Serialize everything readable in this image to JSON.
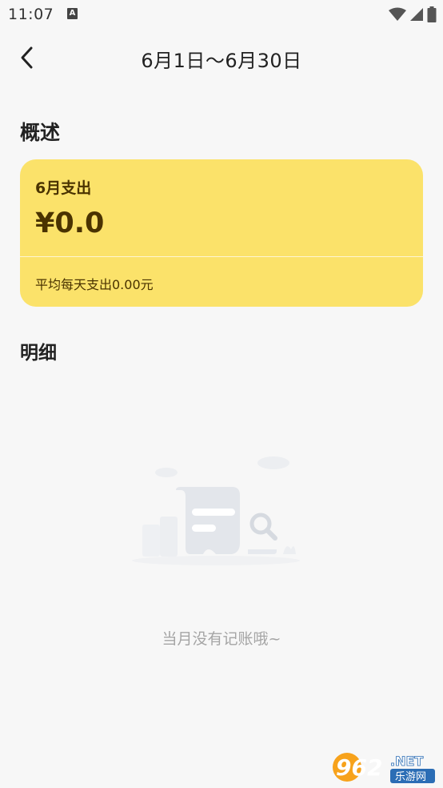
{
  "status_bar": {
    "time": "11:07",
    "notification_icon": "a-icon",
    "notification_letter": "A",
    "icons": [
      "wifi-icon",
      "signal-icon",
      "battery-icon"
    ]
  },
  "header": {
    "back_icon": "chevron-left-icon",
    "title": "6月1日～6月30日"
  },
  "overview": {
    "section_title": "概述",
    "card": {
      "month_label": "6月支出",
      "amount": "¥0.0",
      "average": "平均每天支出0.00元",
      "background": "#fbe26a",
      "text_color": "#4a3300"
    }
  },
  "detail": {
    "section_title": "明细",
    "empty_icon": "empty-receipt-icon",
    "empty_message": "当月没有记账哦~"
  },
  "watermark": {
    "brand": "962.NET",
    "sub": "乐游网"
  }
}
